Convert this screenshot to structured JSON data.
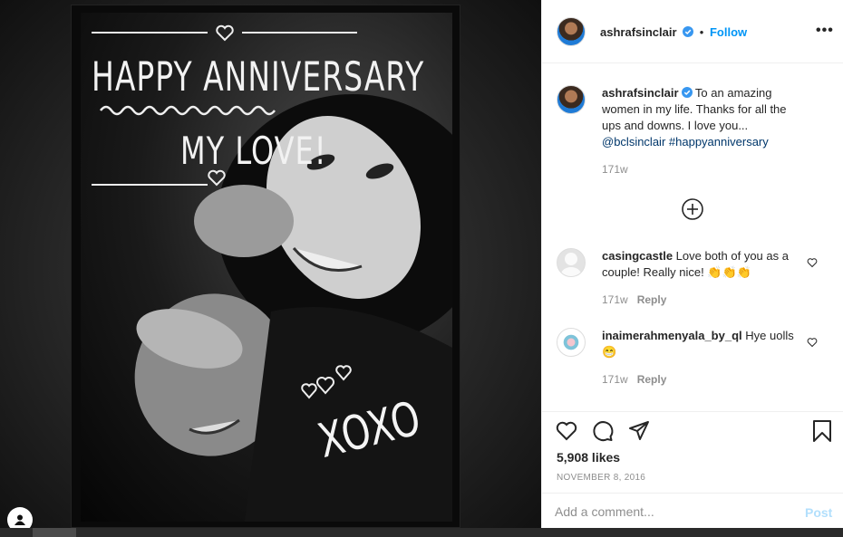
{
  "photo": {
    "card_title": "HAPPY ANNIVERSARY",
    "card_subtitle": "MY LOVE!",
    "card_xoxo": "XOXO"
  },
  "post": {
    "author": "ashrafsinclair",
    "verified": true,
    "follow_separator": "•",
    "follow_label": "Follow",
    "more_options_label": "•••"
  },
  "caption": {
    "username": "ashrafsinclair",
    "text": " To an amazing women in my life. Thanks for all the ups and downs. I love you...",
    "mention": "@bclsinclair",
    "hashtag": "#happyanniversary",
    "age": "171w"
  },
  "comments": [
    {
      "username": "casingcastle",
      "text": " Love both of you as a couple! Really nice! 👏👏👏",
      "age": "171w",
      "reply_label": "Reply"
    },
    {
      "username": "inaimerahmenyala_by_ql",
      "text": " Hye uolls 😁",
      "age": "171w",
      "reply_label": "Reply"
    }
  ],
  "likes": {
    "count": "5,908 likes"
  },
  "date": "NOVEMBER 8, 2016",
  "comment_box": {
    "placeholder": "Add a comment...",
    "post_label": "Post"
  },
  "icons": {
    "like": "heart-icon",
    "comment": "comment-bubble-icon",
    "share": "paper-plane-icon",
    "save": "bookmark-icon",
    "load_more": "plus-circle-icon",
    "verified": "verified-badge-icon"
  },
  "colors": {
    "link_blue": "#0095f6",
    "verified_blue": "#3897f0",
    "post_disabled": "#b2dffc"
  }
}
